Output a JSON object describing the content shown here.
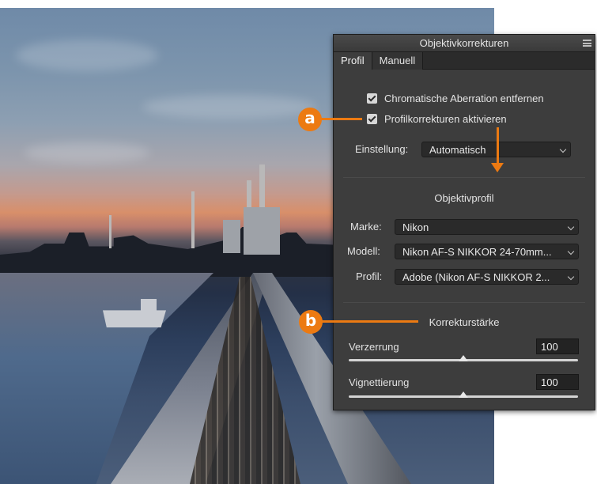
{
  "panel": {
    "title": "Objektivkorrekturen",
    "tabs": [
      {
        "label": "Profil",
        "active": true
      },
      {
        "label": "Manuell",
        "active": false
      }
    ],
    "checkboxes": [
      {
        "label": "Chromatische Aberration entfernen",
        "checked": true
      },
      {
        "label": "Profilkorrekturen aktivieren",
        "checked": true
      }
    ],
    "setting": {
      "label": "Einstellung:",
      "value": "Automatisch"
    },
    "lens_profile": {
      "title": "Objektivprofil",
      "make": {
        "label": "Marke:",
        "value": "Nikon"
      },
      "model": {
        "label": "Modell:",
        "value": "Nikon AF-S NIKKOR 24-70mm..."
      },
      "profile": {
        "label": "Profil:",
        "value": "Adobe (Nikon AF-S NIKKOR 2..."
      }
    },
    "correction": {
      "title": "Korrekturstärke",
      "distortion": {
        "label": "Verzerrung",
        "value": "100",
        "slider_percent": 50
      },
      "vignetting": {
        "label": "Vignettierung",
        "value": "100",
        "slider_percent": 50
      }
    }
  },
  "callouts": {
    "a": "a",
    "b": "b"
  },
  "colors": {
    "panel_bg": "#3d3d3d",
    "callout": "#ec7a12"
  }
}
